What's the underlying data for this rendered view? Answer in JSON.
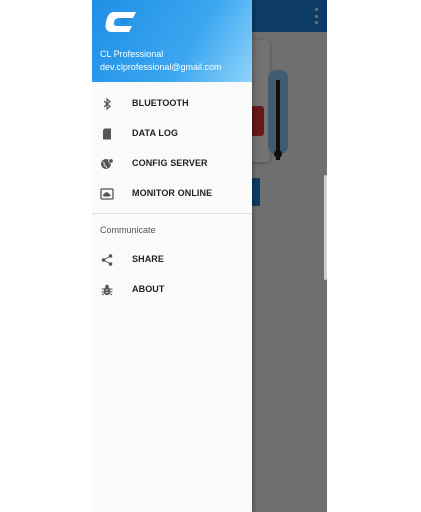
{
  "drawer": {
    "user_name": "CL Professional",
    "user_email": "dev.clprofessional@gmail.com",
    "primary_items": [
      {
        "label": "BLUETOOTH",
        "icon": "bluetooth-icon"
      },
      {
        "label": "DATA LOG",
        "icon": "sd-card-icon"
      },
      {
        "label": "CONFIG SERVER",
        "icon": "globe-settings-icon"
      },
      {
        "label": "MONITOR ONLINE",
        "icon": "cloud-monitor-icon"
      }
    ],
    "section_title": "Communicate",
    "secondary_items": [
      {
        "label": "SHARE",
        "icon": "share-icon"
      },
      {
        "label": "ABOUT",
        "icon": "bug-icon"
      }
    ]
  },
  "colors": {
    "header_start": "#1f8fe6",
    "header_end": "#8fd3fa",
    "app_toolbar": "#1e88e5",
    "scrim": "rgba(0,0,0,0.55)"
  }
}
